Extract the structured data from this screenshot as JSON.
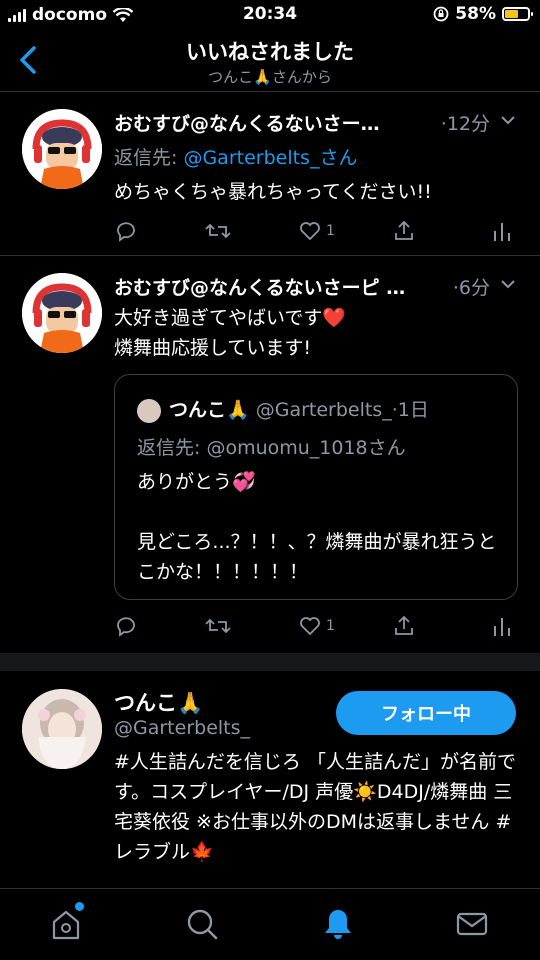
{
  "status_bar": {
    "carrier": "docomo",
    "time": "20:34",
    "battery_percent": "58%",
    "battery_level": 0.58,
    "battery_color": "#f4c419"
  },
  "header": {
    "title": "いいねされました",
    "subtitle": "つんこ🙏さんから"
  },
  "tweets": [
    {
      "name": "おむすび@なんくるないさー…",
      "time": "·12分",
      "reply_prefix": "返信先: ",
      "reply_handle": "@Garterbelts_さん",
      "text": "めちゃくちゃ暴れちゃってください!!",
      "like_count": "1"
    },
    {
      "name": "おむすび@なんくるないさーピ …",
      "time": "·6分",
      "text_line1": "大好き過ぎてやばいです❤️",
      "text_line2": "燐舞曲応援しています!",
      "like_count": "1",
      "quote": {
        "name": "つんこ🙏",
        "handle": "@Garterbelts_·1日",
        "reply": "返信先: @omuomu_1018さん",
        "text": "ありがとう💞\n\n見どころ...？！！、？燐舞曲が暴れ狂うとこかな！！！！！！"
      }
    }
  ],
  "user_card": {
    "name": "つんこ🙏",
    "handle": "@Garterbelts_",
    "follow_label": "フォロー中",
    "bio": "#人生詰んだを信じろ 「人生詰んだ」が名前です。コスプレイヤー/DJ 声優☀️D4DJ/燐舞曲 三宅葵依役 ※お仕事以外のDMは返事しません #レラブル🍁"
  },
  "tab_bar": {
    "items": [
      "home-icon",
      "search-icon",
      "notifications-icon",
      "messages-icon"
    ],
    "active": "notifications-icon",
    "accent": "#1d9bf0"
  }
}
